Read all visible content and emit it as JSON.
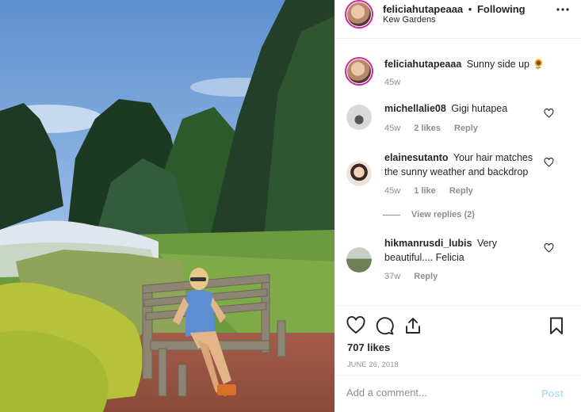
{
  "header": {
    "username": "feliciahutapeaaa",
    "separator": "•",
    "follow_status": "Following",
    "location": "Kew Gardens",
    "more_icon": "more-horizontal-icon"
  },
  "caption": {
    "username": "feliciahutapeaaa",
    "text": "Sunny side up 🌻",
    "time": "45w"
  },
  "comments": [
    {
      "username": "michellalie08",
      "text": "Gigi hutapea",
      "time": "45w",
      "likes": "2 likes",
      "reply": "Reply"
    },
    {
      "username": "elainesutanto",
      "text": "Your hair matches the sunny weather and backdrop",
      "time": "45w",
      "likes": "1 like",
      "reply": "Reply",
      "view_replies": "View replies (2)"
    },
    {
      "username": "hikmanrusdi_lubis",
      "text": "Very beautiful.... Felicia",
      "time": "37w",
      "reply": "Reply"
    }
  ],
  "post_footer": {
    "likes": "707 likes",
    "date": "June 26, 2018",
    "comment_placeholder": "Add a comment...",
    "post_label": "Post"
  },
  "colors": {
    "story_ring": "#d6249f",
    "post_disabled": "#b2dffc",
    "meta_gray": "#8e8e8e"
  }
}
